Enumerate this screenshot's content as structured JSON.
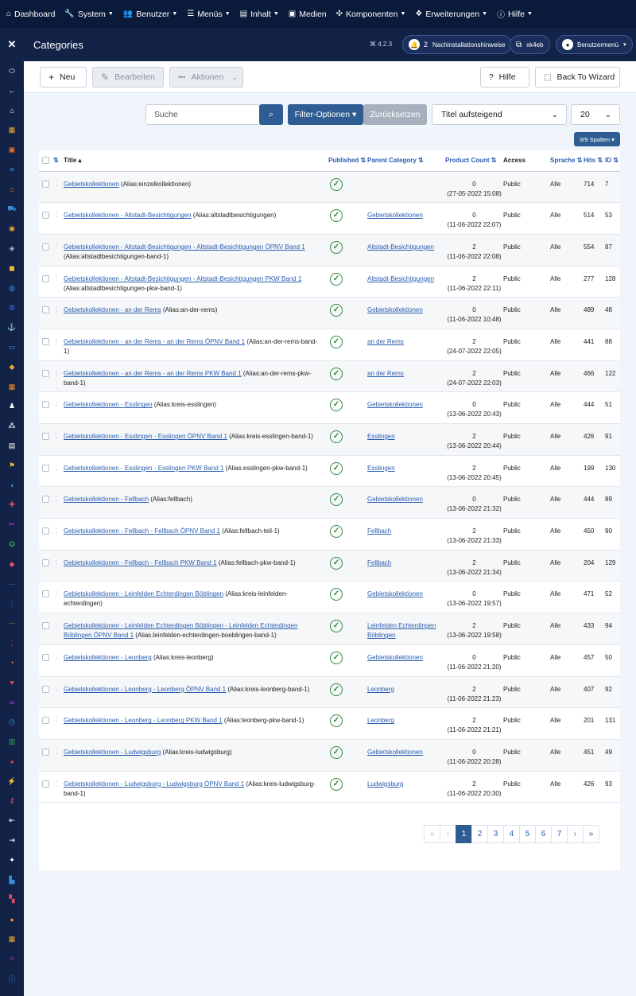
{
  "topmenu": [
    {
      "icon": "home-icon",
      "glyph": "⌂",
      "label": "Dashboard",
      "caret": false
    },
    {
      "icon": "wrench-icon",
      "glyph": "🔧",
      "label": "System",
      "caret": true
    },
    {
      "icon": "users-icon",
      "glyph": "👥",
      "label": "Benutzer",
      "caret": true
    },
    {
      "icon": "list-icon",
      "glyph": "☰",
      "label": "Menüs",
      "caret": true
    },
    {
      "icon": "file-icon",
      "glyph": "▤",
      "label": "Inhalt",
      "caret": true
    },
    {
      "icon": "image-icon",
      "glyph": "▣",
      "label": "Medien",
      "caret": false
    },
    {
      "icon": "cubes-icon",
      "glyph": "✣",
      "label": "Komponenten",
      "caret": true
    },
    {
      "icon": "extensions-icon",
      "glyph": "❖",
      "label": "Erweiterungen",
      "caret": true
    },
    {
      "icon": "info-icon",
      "glyph": "ⓘ",
      "label": "Hilfe",
      "caret": true
    }
  ],
  "header": {
    "title": "Categories",
    "version": "⌘ 4.2.3",
    "notifications_count": "2",
    "notifications_label": "Nachinstallationshinweise",
    "site_label": "xk4eb",
    "user_menu_label": "Benutzermenü"
  },
  "toolbar": {
    "new_label": "Neu",
    "edit_label": "Bearbeiten",
    "actions_label": "Aktionen",
    "help_label": "Hilfe",
    "wizard_label": "Back To Wizard"
  },
  "filters": {
    "search_placeholder": "Suche",
    "filter_options_label": "Filter-Optionen ▾",
    "reset_label": "Zurücksetzen",
    "sort_value": "Titel aufsteigend",
    "limit_value": "20",
    "columns_label": "9/9 Spalten ▾"
  },
  "table": {
    "headers": {
      "title": "Title ▴",
      "published": "Published",
      "parent": "Parent Category",
      "product_count": "Product Count",
      "access": "Access",
      "language": "Sprache",
      "hits": "Hits",
      "id": "ID"
    },
    "rows": [
      {
        "title": "Gebietskollektionen",
        "alias": " (Alias:einzelkollektionen)",
        "parent": "",
        "count": "0",
        "date": "(27-05-2022 15:08)",
        "access": "Public",
        "lang": "Alle",
        "hits": "714",
        "id": "7"
      },
      {
        "title": "Gebietskollektionen - Altstadt-Besichtigungen",
        "alias": " (Alias:altstadtbesichtigungen)",
        "parent": "Gebietskollektionen",
        "count": "0",
        "date": "(11-06-2022 22:07)",
        "access": "Public",
        "lang": "Alle",
        "hits": "514",
        "id": "53"
      },
      {
        "title": "Gebietskollektionen - Altstadt-Besichtigungen - Altstadt-Besichtigungen ÖPNV Band 1",
        "alias": " (Alias:altstadtbesichtigungen-band-1)",
        "parent": "Altstadt-Besichtigungen",
        "count": "2",
        "date": "(11-06-2022 22:08)",
        "access": "Public",
        "lang": "Alle",
        "hits": "554",
        "id": "87"
      },
      {
        "title": "Gebietskollektionen - Altstadt-Besichtigungen - Altstadt-Besichtigungen PKW Band 1",
        "alias": " (Alias:altstadtbesichtigungen-pkw-band-1)",
        "parent": "Altstadt-Besichtigungen",
        "count": "2",
        "date": "(11-06-2022 22:11)",
        "access": "Public",
        "lang": "Alle",
        "hits": "277",
        "id": "128"
      },
      {
        "title": "Gebietskollektionen - an der Rems",
        "alias": " (Alias:an-der-rems)",
        "parent": "Gebietskollektionen",
        "count": "0",
        "date": "(11-06-2022 10:48)",
        "access": "Public",
        "lang": "Alle",
        "hits": "489",
        "id": "48"
      },
      {
        "title": "Gebietskollektionen - an der Rems - an der Rems ÖPNV Band 1",
        "alias": " (Alias:an-der-rems-band-1)",
        "parent": "an der Rems",
        "count": "2",
        "date": "(24-07-2022 22:05)",
        "access": "Public",
        "lang": "Alle",
        "hits": "441",
        "id": "88"
      },
      {
        "title": "Gebietskollektionen - an der Rems - an der Rems PKW Band 1",
        "alias": " (Alias:an-der-rems-pkw-band-1)",
        "parent": "an der Rems",
        "count": "2",
        "date": "(24-07-2022 22:03)",
        "access": "Public",
        "lang": "Alle",
        "hits": "466",
        "id": "122"
      },
      {
        "title": "Gebietskollektionen - Esslingen",
        "alias": " (Alias:kreis-esslingen)",
        "parent": "Gebietskollektionen",
        "count": "0",
        "date": "(13-06-2022 20:43)",
        "access": "Public",
        "lang": "Alle",
        "hits": "444",
        "id": "51"
      },
      {
        "title": "Gebietskollektionen - Esslingen - Esslingen ÖPNV Band 1",
        "alias": " (Alias:kreis-esslingen-band-1)",
        "parent": "Esslingen",
        "count": "2",
        "date": "(13-06-2022 20:44)",
        "access": "Public",
        "lang": "Alle",
        "hits": "426",
        "id": "91"
      },
      {
        "title": "Gebietskollektionen - Esslingen - Esslingen PKW Band 1",
        "alias": " (Alias:esslingen-pkw-band-1)",
        "parent": "Esslingen",
        "count": "2",
        "date": "(13-06-2022 20:45)",
        "access": "Public",
        "lang": "Alle",
        "hits": "199",
        "id": "130"
      },
      {
        "title": "Gebietskollektionen - Fellbach",
        "alias": " (Alias:fellbach)",
        "parent": "Gebietskollektionen",
        "count": "0",
        "date": "(13-06-2022 21:32)",
        "access": "Public",
        "lang": "Alle",
        "hits": "444",
        "id": "89"
      },
      {
        "title": "Gebietskollektionen - Fellbach - Fellbach ÖPNV Band 1",
        "alias": " (Alias:fellbach-teil-1)",
        "parent": "Fellbach",
        "count": "2",
        "date": "(13-06-2022 21:33)",
        "access": "Public",
        "lang": "Alle",
        "hits": "450",
        "id": "90"
      },
      {
        "title": "Gebietskollektionen - Fellbach - Fellbach PKW Band 1",
        "alias": " (Alias:fellbach-pkw-band-1)",
        "parent": "Fellbach",
        "count": "2",
        "date": "(13-06-2022 21:34)",
        "access": "Public",
        "lang": "Alle",
        "hits": "204",
        "id": "129"
      },
      {
        "title": "Gebietskollektionen - Leinfelden Echterdingen Böblingen",
        "alias": " (Alias:kreis-leinfelden-echterdingen)",
        "parent": "Gebietskollektionen",
        "count": "0",
        "date": "(13-06-2022 19:57)",
        "access": "Public",
        "lang": "Alle",
        "hits": "471",
        "id": "52"
      },
      {
        "title": "Gebietskollektionen - Leinfelden Echterdingen Böblingen - Leinfelden Echterdingen Böblingen ÖPNV Band 1",
        "alias": " (Alias:leinfelden-echterdingen-boeblingen-band-1)",
        "parent": "Leinfelden Echterdingen Böblingen",
        "count": "2",
        "date": "(13-06-2022 19:58)",
        "access": "Public",
        "lang": "Alle",
        "hits": "433",
        "id": "94"
      },
      {
        "title": "Gebietskollektionen - Leonberg",
        "alias": " (Alias:kreis-leonberg)",
        "parent": "Gebietskollektionen",
        "count": "0",
        "date": "(11-06-2022 21:20)",
        "access": "Public",
        "lang": "Alle",
        "hits": "457",
        "id": "50"
      },
      {
        "title": "Gebietskollektionen - Leonberg - Leonberg ÖPNV Band 1",
        "alias": " (Alias:kreis-leonberg-band-1)",
        "parent": "Leonberg",
        "count": "2",
        "date": "(11-06-2022 21:23)",
        "access": "Public",
        "lang": "Alle",
        "hits": "407",
        "id": "92"
      },
      {
        "title": "Gebietskollektionen - Leonberg - Leonberg PKW Band 1",
        "alias": " (Alias:leonberg-pkw-band-1)",
        "parent": "Leonberg",
        "count": "2",
        "date": "(11-06-2022 21:21)",
        "access": "Public",
        "lang": "Alle",
        "hits": "201",
        "id": "131"
      },
      {
        "title": "Gebietskollektionen - Ludwigsburg",
        "alias": " (Alias:kreis-ludwigsburg)",
        "parent": "Gebietskollektionen",
        "count": "0",
        "date": "(11-06-2022 20:28)",
        "access": "Public",
        "lang": "Alle",
        "hits": "451",
        "id": "49"
      },
      {
        "title": "Gebietskollektionen - Ludwigsburg - Ludwigsburg ÖPNV Band 1",
        "alias": " (Alias:kreis-ludwigsburg-band-1)",
        "parent": "Ludwigsburg",
        "count": "2",
        "date": "(11-06-2022 20:30)",
        "access": "Public",
        "lang": "Alle",
        "hits": "426",
        "id": "93"
      }
    ]
  },
  "pagination": {
    "pages": [
      "«",
      "‹",
      "1",
      "2",
      "3",
      "4",
      "5",
      "6",
      "7",
      "›",
      "»"
    ],
    "active": "1"
  },
  "sidebar_icons": [
    {
      "name": "toggle-icon",
      "glyph": "⬭",
      "color": "#ffffff"
    },
    {
      "name": "back-arrow-icon",
      "glyph": "←",
      "color": "#ffffff"
    },
    {
      "name": "home-icon",
      "glyph": "⌂",
      "color": "#ffffff"
    },
    {
      "name": "archive-icon",
      "glyph": "▦",
      "color": "#f0a830"
    },
    {
      "name": "box-icon",
      "glyph": "▣",
      "color": "#e8742a"
    },
    {
      "name": "sliders-icon",
      "glyph": "≡",
      "color": "#3b8fd8"
    },
    {
      "name": "store-icon",
      "glyph": "⌂",
      "color": "#f08a24"
    },
    {
      "name": "cart-icon",
      "glyph": "⛟",
      "color": "#3b8fd8"
    },
    {
      "name": "coins-icon",
      "glyph": "◉",
      "color": "#f0a830"
    },
    {
      "name": "layers-icon",
      "glyph": "◈",
      "color": "#b0b8c8"
    },
    {
      "name": "cube-icon",
      "glyph": "◼",
      "color": "#f0c030"
    },
    {
      "name": "globe-icon",
      "glyph": "◍",
      "color": "#3b8fd8"
    },
    {
      "name": "globe-alt-icon",
      "glyph": "◍",
      "color": "#3b70d8"
    },
    {
      "name": "anchor-icon",
      "glyph": "⚓",
      "color": "#ffffff"
    },
    {
      "name": "credit-card-icon",
      "glyph": "▭",
      "color": "#3b8fd8"
    },
    {
      "name": "bookmark-icon",
      "glyph": "◆",
      "color": "#f0a830"
    },
    {
      "name": "calendar-icon",
      "glyph": "▦",
      "color": "#f08a24"
    },
    {
      "name": "user-tie-icon",
      "glyph": "♟",
      "color": "#ffffff"
    },
    {
      "name": "team-icon",
      "glyph": "⁂",
      "color": "#ffffff"
    },
    {
      "name": "id-card-icon",
      "glyph": "▤",
      "color": "#ffffff"
    },
    {
      "name": "flag-icon",
      "glyph": "⚑",
      "color": "#f0c030"
    },
    {
      "name": "comment-icon",
      "glyph": "◖",
      "color": "#3b8fd8"
    },
    {
      "name": "gift-icon",
      "glyph": "✚",
      "color": "#e84a5f"
    },
    {
      "name": "scissors-icon",
      "glyph": "✂",
      "color": "#c040d8"
    },
    {
      "name": "award-icon",
      "glyph": "✪",
      "color": "#2fa84f"
    },
    {
      "name": "tag-icon",
      "glyph": "◆",
      "color": "#e84a5f"
    },
    {
      "name": "dots-horizontal-icon",
      "glyph": "⋯",
      "color": "#3b8fd8"
    },
    {
      "name": "dots-vertical-icon",
      "glyph": "⋮",
      "color": "#3b8fd8"
    },
    {
      "name": "dots-orange-icon",
      "glyph": "⋯",
      "color": "#f08a24"
    },
    {
      "name": "dots-red-icon",
      "glyph": "⋮",
      "color": "#e84a5f"
    },
    {
      "name": "rss-icon",
      "glyph": "◔",
      "color": "#f0a830"
    },
    {
      "name": "heart-icon",
      "glyph": "♥",
      "color": "#e84a5f"
    },
    {
      "name": "link-icon",
      "glyph": "∞",
      "color": "#c040d8"
    },
    {
      "name": "clock-icon",
      "glyph": "◷",
      "color": "#3b8fd8"
    },
    {
      "name": "copy-icon",
      "glyph": "▥",
      "color": "#2fa84f"
    },
    {
      "name": "pie-chart-icon",
      "glyph": "◕",
      "color": "#e84a5f"
    },
    {
      "name": "plug-icon",
      "glyph": "⚡",
      "color": "#c03030"
    },
    {
      "name": "key-icon",
      "glyph": "⚷",
      "color": "#e84a5f"
    },
    {
      "name": "logout-icon",
      "glyph": "⇤",
      "color": "#ffffff"
    },
    {
      "name": "login-icon",
      "glyph": "⇥",
      "color": "#ffffff"
    },
    {
      "name": "puzzle-icon",
      "glyph": "✦",
      "color": "#ffffff"
    },
    {
      "name": "building-icon",
      "glyph": "▙",
      "color": "#3b8fd8"
    },
    {
      "name": "palette-icon",
      "glyph": "▚",
      "color": "#e84a5f"
    },
    {
      "name": "fire-icon",
      "glyph": "●",
      "color": "#f08a24"
    },
    {
      "name": "grid-icon",
      "glyph": "▦",
      "color": "#f0a830"
    },
    {
      "name": "magic-icon",
      "glyph": "✧",
      "color": "#c040d8"
    },
    {
      "name": "info-circle-icon",
      "glyph": "ⓘ",
      "color": "#3b8fd8"
    }
  ]
}
